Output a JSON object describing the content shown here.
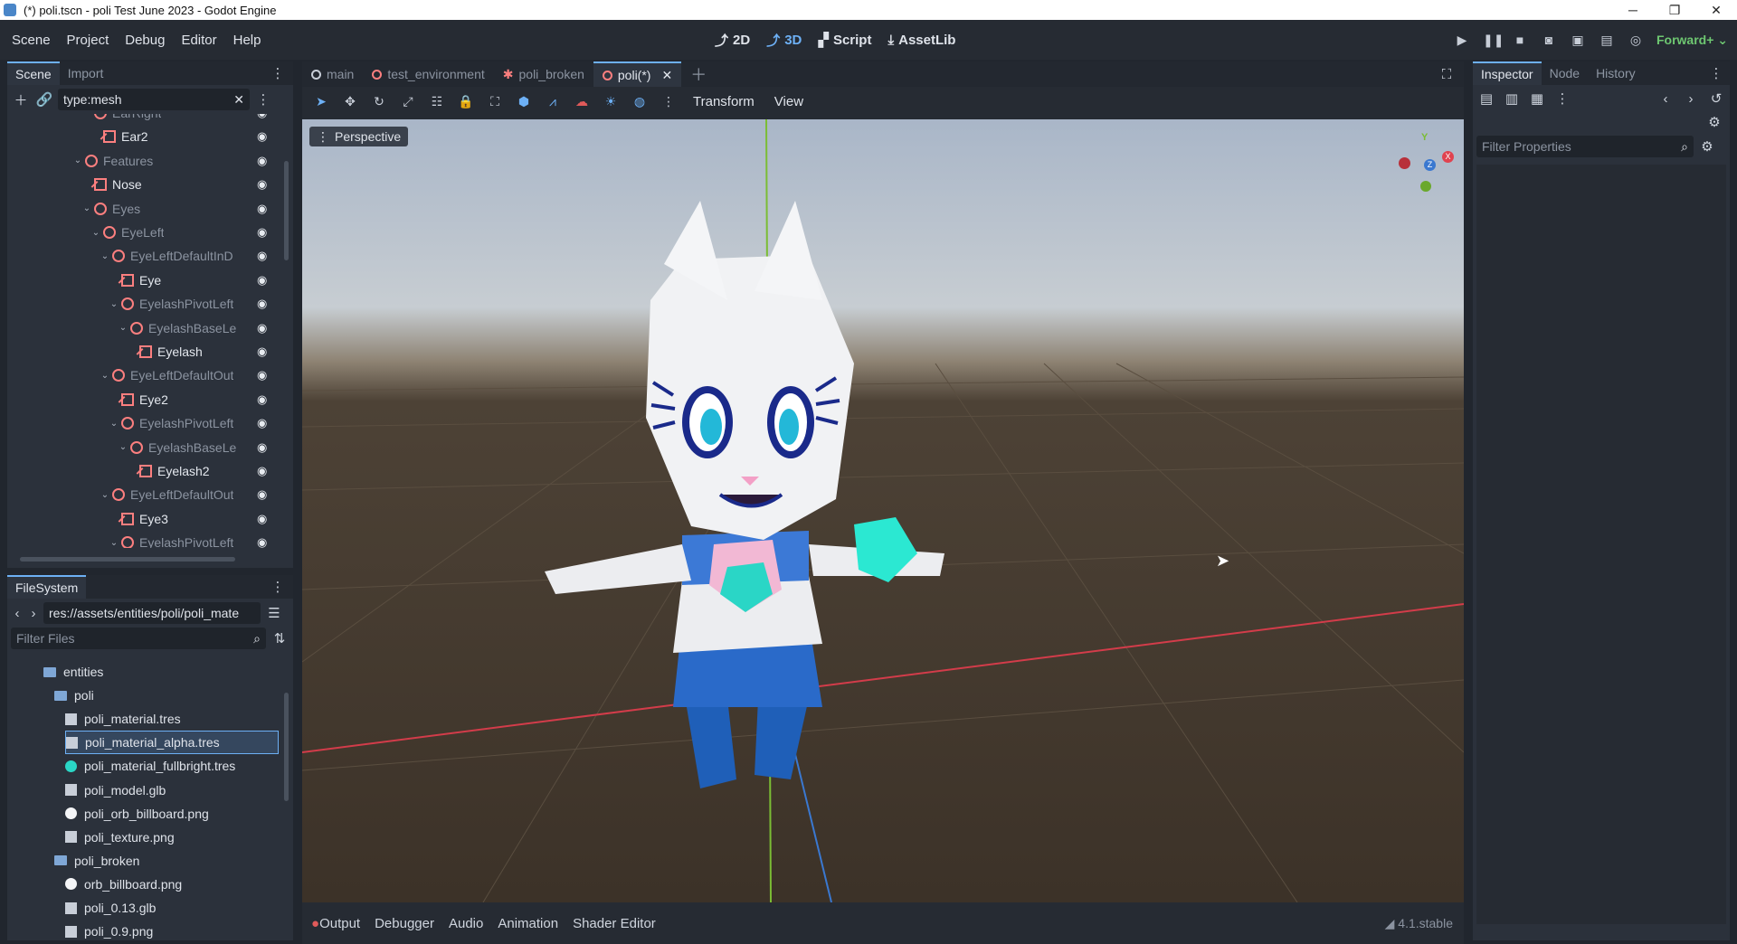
{
  "window": {
    "title": "(*) poli.tscn - poli Test June 2023 - Godot Engine",
    "minimize": "─",
    "maximize": "❐",
    "close": "✕"
  },
  "menu": [
    "Scene",
    "Project",
    "Debug",
    "Editor",
    "Help"
  ],
  "main_screens": [
    {
      "label": "2D",
      "icon": "2d-icon"
    },
    {
      "label": "3D",
      "icon": "3d-icon"
    },
    {
      "label": "Script",
      "icon": "script-icon"
    },
    {
      "label": "AssetLib",
      "icon": "assetlib-icon"
    }
  ],
  "renderer": "Forward+",
  "scene_dock": {
    "tabs": [
      "Scene",
      "Import"
    ],
    "filter_value": "type:mesh",
    "tree": [
      {
        "label": "EarRight",
        "depth": 2,
        "icon": "node3d",
        "dim": true,
        "arrow": ""
      },
      {
        "label": "Ear2",
        "depth": 3,
        "icon": "mesh",
        "dim": false,
        "arrow": ""
      },
      {
        "label": "Features",
        "depth": 1,
        "icon": "node3d",
        "dim": true,
        "arrow": "v"
      },
      {
        "label": "Nose",
        "depth": 2,
        "icon": "mesh",
        "dim": false,
        "arrow": ""
      },
      {
        "label": "Eyes",
        "depth": 2,
        "icon": "node3d",
        "dim": true,
        "arrow": "v"
      },
      {
        "label": "EyeLeft",
        "depth": 3,
        "icon": "node3d",
        "dim": true,
        "arrow": "v"
      },
      {
        "label": "EyeLeftDefaultInD",
        "depth": 4,
        "icon": "node3d",
        "dim": true,
        "arrow": "v"
      },
      {
        "label": "Eye",
        "depth": 5,
        "icon": "mesh",
        "dim": false,
        "arrow": ""
      },
      {
        "label": "EyelashPivotLeft",
        "depth": 5,
        "icon": "node3d",
        "dim": true,
        "arrow": "v"
      },
      {
        "label": "EyelashBaseLe",
        "depth": 6,
        "icon": "node3d",
        "dim": true,
        "arrow": "v"
      },
      {
        "label": "Eyelash",
        "depth": 7,
        "icon": "mesh",
        "dim": false,
        "arrow": ""
      },
      {
        "label": "EyeLeftDefaultOut",
        "depth": 4,
        "icon": "node3d",
        "dim": true,
        "arrow": "v"
      },
      {
        "label": "Eye2",
        "depth": 5,
        "icon": "mesh",
        "dim": false,
        "arrow": ""
      },
      {
        "label": "EyelashPivotLeft",
        "depth": 5,
        "icon": "node3d",
        "dim": true,
        "arrow": "v"
      },
      {
        "label": "EyelashBaseLe",
        "depth": 6,
        "icon": "node3d",
        "dim": true,
        "arrow": "v"
      },
      {
        "label": "Eyelash2",
        "depth": 7,
        "icon": "mesh",
        "dim": false,
        "arrow": ""
      },
      {
        "label": "EyeLeftDefaultOut",
        "depth": 4,
        "icon": "node3d",
        "dim": true,
        "arrow": "v"
      },
      {
        "label": "Eye3",
        "depth": 5,
        "icon": "mesh",
        "dim": false,
        "arrow": ""
      },
      {
        "label": "EyelashPivotLeft",
        "depth": 5,
        "icon": "node3d",
        "dim": true,
        "arrow": "v"
      }
    ]
  },
  "filesystem_dock": {
    "tab": "FileSystem",
    "path": "res://assets/entities/poli/poli_mate",
    "filter_placeholder": "Filter Files",
    "items": [
      {
        "label": "entities",
        "depth": 1,
        "type": "folder"
      },
      {
        "label": "poli",
        "depth": 2,
        "type": "folder"
      },
      {
        "label": "poli_material.tres",
        "depth": 3,
        "type": "material",
        "selected": false
      },
      {
        "label": "poli_material_alpha.tres",
        "depth": 3,
        "type": "material",
        "selected": true
      },
      {
        "label": "poli_material_fullbright.tres",
        "depth": 3,
        "type": "material-teal",
        "selected": false
      },
      {
        "label": "poli_model.glb",
        "depth": 3,
        "type": "scene-file",
        "selected": false
      },
      {
        "label": "poli_orb_billboard.png",
        "depth": 3,
        "type": "image-white",
        "selected": false
      },
      {
        "label": "poli_texture.png",
        "depth": 3,
        "type": "image",
        "selected": false
      },
      {
        "label": "poli_broken",
        "depth": 2,
        "type": "folder"
      },
      {
        "label": "orb_billboard.png",
        "depth": 3,
        "type": "image-white",
        "selected": false
      },
      {
        "label": "poli_0.13.glb",
        "depth": 3,
        "type": "scene-file",
        "selected": false
      },
      {
        "label": "poli_0.9.png",
        "depth": 3,
        "type": "image",
        "selected": false
      }
    ]
  },
  "scene_tabs": [
    {
      "label": "main",
      "icon": "node3d-ring",
      "active": false
    },
    {
      "label": "test_environment",
      "icon": "node3d-ring",
      "active": false
    },
    {
      "label": "poli_broken",
      "icon": "animation-icon",
      "active": false
    },
    {
      "label": "poli(*)",
      "icon": "node3d-ring",
      "active": true
    }
  ],
  "viewport_toolbar": {
    "menus": [
      "Transform",
      "View"
    ]
  },
  "viewport": {
    "label": "Perspective",
    "gizmo_axes": [
      "Y",
      "X",
      "Z"
    ]
  },
  "bottom_panel": {
    "tabs": [
      "Output",
      "Debugger",
      "Audio",
      "Animation",
      "Shader Editor"
    ],
    "version": "4.1.stable"
  },
  "inspector_dock": {
    "tabs": [
      "Inspector",
      "Node",
      "History"
    ],
    "filter_placeholder": "Filter Properties"
  },
  "colors": {
    "accent": "#6db0f5",
    "node3d": "#fc7f7f",
    "renderer": "#6ec771"
  }
}
